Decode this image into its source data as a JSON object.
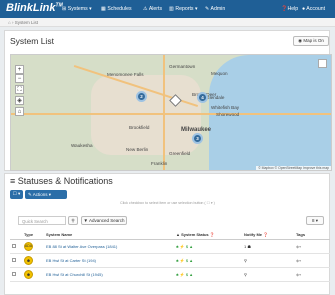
{
  "brand": {
    "name": "BlinkLink",
    "tm": "TM"
  },
  "nav": {
    "systems": "Systems",
    "schedules": "Schedules",
    "alerts": "Alerts",
    "reports": "Reports",
    "admin": "Admin",
    "help": "Help",
    "account": "Account"
  },
  "breadcrumb": "System List",
  "page": {
    "title": "System List",
    "map_toggle": "Map is On"
  },
  "map": {
    "clusters": [
      "2",
      "4",
      "3"
    ],
    "towns": [
      "Menomonee Falls",
      "Germantown",
      "Mequon",
      "Brown Deer",
      "Glendale",
      "Whitefish Bay",
      "Shorewood",
      "Brookfield",
      "Milwaukee",
      "Waukesha",
      "New Berlin",
      "Greenfield",
      "Franklin"
    ],
    "attribution": "© Mapbox © OpenStreetMap Improve this map"
  },
  "section": {
    "title": "Statuses & Notifications",
    "actions_label": "Actions",
    "hint": "Click checkbox to select item or use selection button ( ☐ ▾ )"
  },
  "filters": {
    "search_placeholder": "Quick Search",
    "advanced": "Advanced Search",
    "per_page": "8"
  },
  "table": {
    "headers": [
      "Type",
      "System Name",
      "System Status",
      "Notify Me",
      "Tags"
    ],
    "rows": [
      {
        "type": "ADA",
        "name": "EB 88 St at Walter Ave Overpass (1841)",
        "notify": "1"
      },
      {
        "type": "EV",
        "name": "EB Hwl St at Carter St (194)",
        "notify": ""
      },
      {
        "type": "EV",
        "name": "EB Hwl St at Churchill St (1945)",
        "notify": ""
      }
    ]
  }
}
